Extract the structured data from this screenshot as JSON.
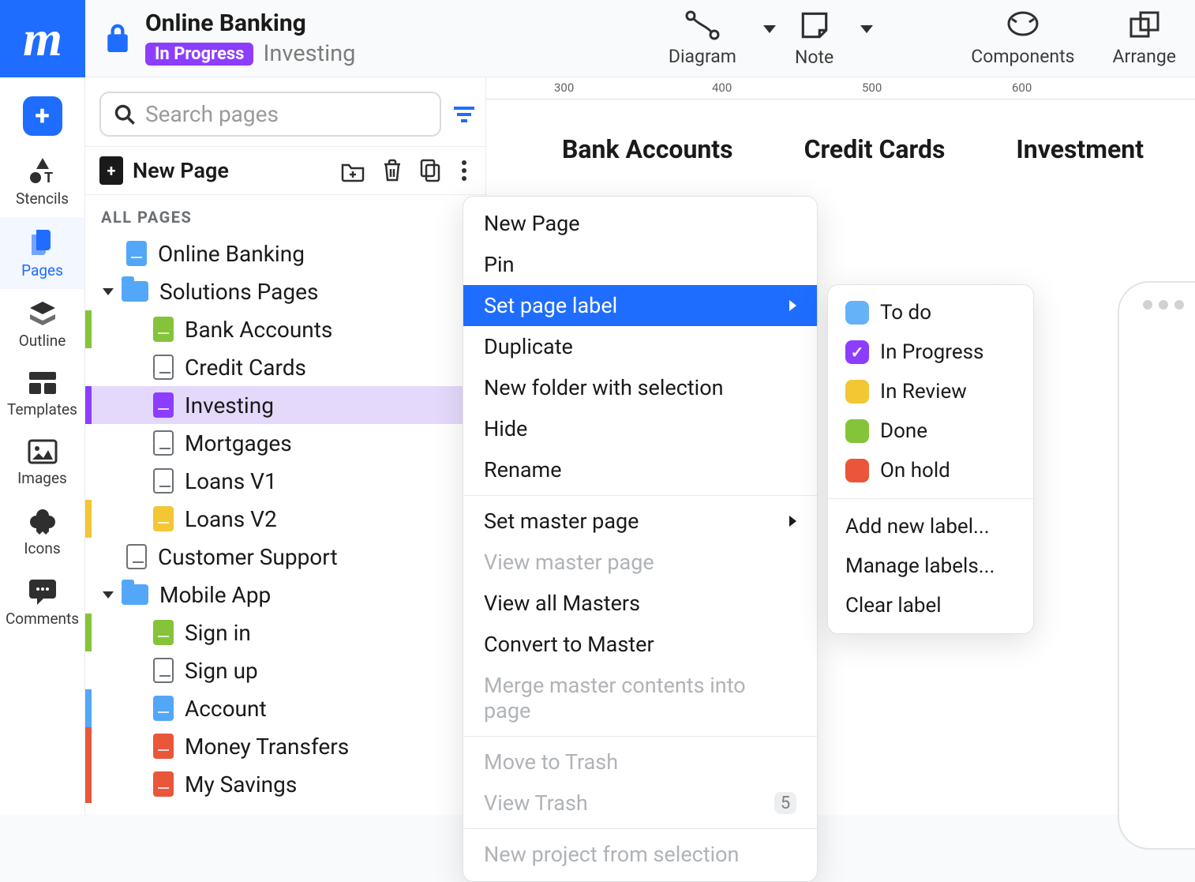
{
  "header": {
    "title": "Online Banking",
    "badge": "In Progress",
    "subtitle": "Investing"
  },
  "toolbar": {
    "diagram": "Diagram",
    "note": "Note",
    "components": "Components",
    "arrange": "Arrange"
  },
  "rail": {
    "stencils": "Stencils",
    "pages": "Pages",
    "outline": "Outline",
    "templates": "Templates",
    "images": "Images",
    "icons": "Icons",
    "comments": "Comments"
  },
  "search": {
    "placeholder": "Search pages"
  },
  "newpage": {
    "label": "New Page"
  },
  "allpages": "ALL PAGES",
  "tree": [
    {
      "name": "Online Banking",
      "icon": "blue",
      "indent": 1
    },
    {
      "name": "Solutions Pages",
      "icon": "folder",
      "indent": 0,
      "caret": true
    },
    {
      "name": "Bank Accounts",
      "icon": "green",
      "indent": 2,
      "bar": "#85c438"
    },
    {
      "name": "Credit Cards",
      "icon": "white",
      "indent": 2
    },
    {
      "name": "Investing",
      "icon": "purple",
      "indent": 2,
      "bar": "#8d3dff",
      "selected": true
    },
    {
      "name": "Mortgages",
      "icon": "white",
      "indent": 2
    },
    {
      "name": "Loans V1",
      "icon": "white",
      "indent": 2
    },
    {
      "name": "Loans V2",
      "icon": "yellow",
      "indent": 2,
      "bar": "#f3c634"
    },
    {
      "name": "Customer Support",
      "icon": "white",
      "indent": 1
    },
    {
      "name": "Mobile App",
      "icon": "folder",
      "indent": 0,
      "caret": true
    },
    {
      "name": "Sign in",
      "icon": "green",
      "indent": 2,
      "bar": "#85c438"
    },
    {
      "name": "Sign up",
      "icon": "white",
      "indent": 2
    },
    {
      "name": "Account",
      "icon": "blue",
      "indent": 2,
      "bar": "#53a7f8"
    },
    {
      "name": "Money Transfers",
      "icon": "red",
      "indent": 2,
      "bar": "#e9563a"
    },
    {
      "name": "My Savings",
      "icon": "red",
      "indent": 2,
      "bar": "#e9563a"
    }
  ],
  "canvas": {
    "tabs": [
      "Bank Accounts",
      "Credit Cards",
      "Investment"
    ],
    "ruler": [
      {
        "pos": 80,
        "label": "300"
      },
      {
        "pos": 280,
        "label": "400"
      },
      {
        "pos": 470,
        "label": "500"
      },
      {
        "pos": 660,
        "label": "600"
      }
    ]
  },
  "context_menu": [
    {
      "label": "New Page"
    },
    {
      "label": "Pin"
    },
    {
      "label": "Set page label",
      "highlighted": true,
      "submenu": true
    },
    {
      "label": "Duplicate"
    },
    {
      "label": "New folder with selection"
    },
    {
      "label": "Hide"
    },
    {
      "label": "Rename"
    },
    {
      "sep": true
    },
    {
      "label": "Set master page",
      "submenu": true
    },
    {
      "label": "View master page",
      "disabled": true
    },
    {
      "label": "View all Masters"
    },
    {
      "label": "Convert to Master"
    },
    {
      "label": "Merge master contents into page",
      "disabled": true
    },
    {
      "sep": true
    },
    {
      "label": "Move to Trash",
      "disabled": true
    },
    {
      "label": "View Trash",
      "disabled": true,
      "count": "5"
    },
    {
      "sep": true
    },
    {
      "label": "New project from selection",
      "disabled": true
    }
  ],
  "label_menu": {
    "labels": [
      {
        "name": "To do",
        "color": "blue"
      },
      {
        "name": "In Progress",
        "color": "purple",
        "checked": true
      },
      {
        "name": "In Review",
        "color": "yellow"
      },
      {
        "name": "Done",
        "color": "green"
      },
      {
        "name": "On hold",
        "color": "red"
      }
    ],
    "actions": [
      "Add new label...",
      "Manage labels...",
      "Clear label"
    ]
  }
}
